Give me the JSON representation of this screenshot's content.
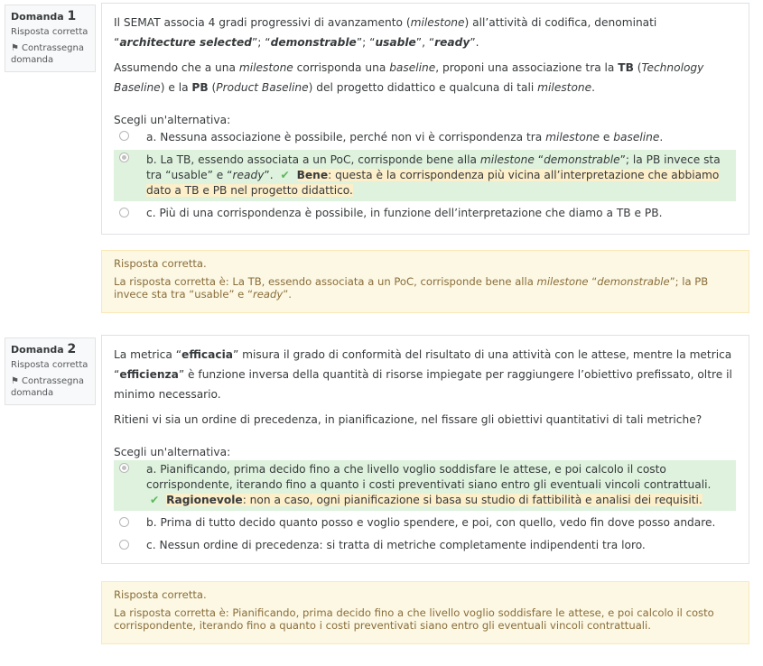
{
  "q1": {
    "label": "Domanda",
    "number": "1",
    "state": "Risposta corretta",
    "flag_label": "Contrassegna domanda",
    "text": {
      "p1_a": "Il SEMAT associa 4 gradi progressivi di avanzamento (",
      "p1_milestone": "milestone",
      "p1_b": ") all’attività di codifica, denominati “",
      "p1_architecture": "architecture selected",
      "p1_c": "”; “",
      "p1_demonstrable": "demonstrable",
      "p1_d": "”; “",
      "p1_usable": "usable",
      "p1_e": "”, “",
      "p1_ready": "ready",
      "p1_f": "”.",
      "p2_a": "Assumendo che a una ",
      "p2_milestone": "milestone",
      "p2_b": " corrisponda una ",
      "p2_baseline": "baseline",
      "p2_c": ", proponi una associazione tra la ",
      "p2_tb": "TB",
      "p2_d": " (",
      "p2_tb_full": "Technology Baseline",
      "p2_e": ") e la ",
      "p2_pb": "PB",
      "p2_f": " (",
      "p2_pb_full": "Product Baseline",
      "p2_g": ") del progetto didattico e qualcuna di tali ",
      "p2_milestone2": "milestone",
      "p2_h": "."
    },
    "prompt": "Scegli un'alternativa:",
    "options": [
      {
        "a1": "a. Nessuna associazione è possibile, perché non vi è corrispondenza tra ",
        "a2": "milestone",
        "a3": " e ",
        "a4": "baseline",
        "a5": "."
      },
      {
        "b1": "b. La TB, essendo associata a un PoC, corrisponde bene alla ",
        "b2": "milestone",
        "b3": " “",
        "b4": "demonstrable",
        "b5": "”; la PB invece sta tra “usable” e “",
        "b6": "ready",
        "b7": "”.",
        "fb_bold": "Bene",
        "fb_text": ": questa è la corrispondenza più vicina all’interpretazione che abbiamo dato a TB e PB nel progetto didattico."
      },
      {
        "c1": "c. Più di una corrispondenza è possibile, in funzione dell’interpretazione che diamo a TB e PB."
      }
    ],
    "outcome_title": "Risposta corretta.",
    "outcome": {
      "t1": "La risposta corretta è: La TB, essendo associata a un PoC, corrisponde bene alla ",
      "t2": "milestone",
      "t3": " “",
      "t4": "demonstrable",
      "t5": "”; la PB invece sta tra “usable” e “",
      "t6": "ready",
      "t7": "”."
    }
  },
  "q2": {
    "label": "Domanda",
    "number": "2",
    "state": "Risposta corretta",
    "flag_label": "Contrassegna domanda",
    "text": {
      "p1_a": "La metrica “",
      "p1_efficacia": "efficacia",
      "p1_b": "” misura il grado di conformità del risultato di una attività con le attese, mentre la metrica “",
      "p1_efficienza": "efficienza",
      "p1_c": "” è funzione inversa della quantità di risorse impiegate per raggiungere l’obiettivo prefissato, oltre il minimo necessario.",
      "p2": "Ritieni vi sia un ordine di precedenza, in pianificazione, nel fissare gli obiettivi quantitativi di tali metriche?"
    },
    "prompt": "Scegli un'alternativa:",
    "options": [
      {
        "a1": "a. Pianificando, prima decido fino a che livello voglio soddisfare le attese, e poi calcolo il costo corrispondente, iterando fino a quanto i costi preventivati siano entro gli eventuali vincoli contrattuali.",
        "fb_bold": "Ragionevole",
        "fb_text": ": non a caso, ogni pianificazione si basa su studio di fattibilità e analisi dei requisiti."
      },
      {
        "b1": "b. Prima di tutto decido quanto posso e voglio spendere, e poi, con quello, vedo fin dove posso andare."
      },
      {
        "c1": "c. Nessun ordine di precedenza: si tratta di metriche completamente indipendenti tra loro."
      }
    ],
    "outcome_title": "Risposta corretta.",
    "outcome": "La risposta corretta è: Pianificando, prima decido fino a che livello voglio soddisfare le attese, e poi calcolo il costo corrispondente, iterando fino a quanto i costi preventivati siano entro gli eventuali vincoli contrattuali."
  },
  "icons": {
    "flag": "flag-icon",
    "check": "check-icon",
    "radio": "radio-button"
  },
  "colors": {
    "correct_bg": "#def2dd",
    "feedback_bg": "#fcefc9",
    "outcome_bg": "#fcf8e3",
    "check": "#5cb85c"
  }
}
